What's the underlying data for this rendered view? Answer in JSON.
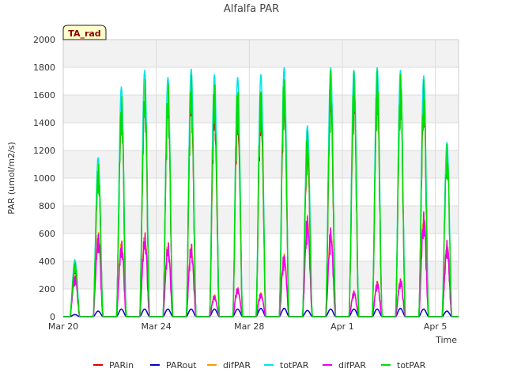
{
  "chart_data": {
    "type": "line",
    "title": "Alfalfa PAR",
    "xlabel": "Time",
    "ylabel": "PAR (umol/m2/s)",
    "ylim": [
      0,
      2000
    ],
    "yticks": [
      0,
      200,
      400,
      600,
      800,
      1000,
      1200,
      1400,
      1600,
      1800,
      2000
    ],
    "xlim": [
      "Mar 20",
      "Apr 6"
    ],
    "xticks": [
      {
        "label": "Mar 20",
        "day": 0
      },
      {
        "label": "Mar 24",
        "day": 4
      },
      {
        "label": "Mar 28",
        "day": 8
      },
      {
        "label": "Apr 1",
        "day": 12
      },
      {
        "label": "Apr 5",
        "day": 16
      }
    ],
    "site_label": "TA_rad",
    "grid": true,
    "legend_position": "bottom",
    "series": [
      {
        "name": "PARin",
        "color": "#dd0000"
      },
      {
        "name": "PARout",
        "color": "#0000cc"
      },
      {
        "name": "difPAR",
        "color": "#ff9900"
      },
      {
        "name": "totPAR",
        "color": "#00e5e5"
      },
      {
        "name": "difPAR",
        "color": "#ee00ee"
      },
      {
        "name": "totPAR",
        "color": "#00dd00"
      }
    ],
    "daily": {
      "date": [
        "Mar 20",
        "Mar 21",
        "Mar 22",
        "Mar 23",
        "Mar 24",
        "Mar 25",
        "Mar 26",
        "Mar 27",
        "Mar 28",
        "Mar 29",
        "Mar 30",
        "Mar 31",
        "Apr 1",
        "Apr 2",
        "Apr 3",
        "Apr 4",
        "Apr 5"
      ],
      "totPAR_peak": [
        410,
        1150,
        1660,
        1780,
        1730,
        1790,
        1750,
        1730,
        1750,
        1800,
        1380,
        1800,
        1780,
        1800,
        1780,
        1740,
        1260
      ],
      "PARin_peak": [
        380,
        1100,
        1600,
        1700,
        1660,
        1700,
        1610,
        1600,
        1620,
        1700,
        1300,
        1700,
        1700,
        1720,
        1700,
        1650,
        530
      ],
      "difPAR_peak": [
        310,
        630,
        570,
        630,
        550,
        540,
        160,
        220,
        180,
        470,
        750,
        650,
        190,
        260,
        280,
        770,
        560
      ],
      "PARout_peak": [
        15,
        40,
        55,
        55,
        55,
        55,
        55,
        55,
        60,
        60,
        45,
        55,
        55,
        55,
        60,
        55,
        40
      ]
    }
  }
}
